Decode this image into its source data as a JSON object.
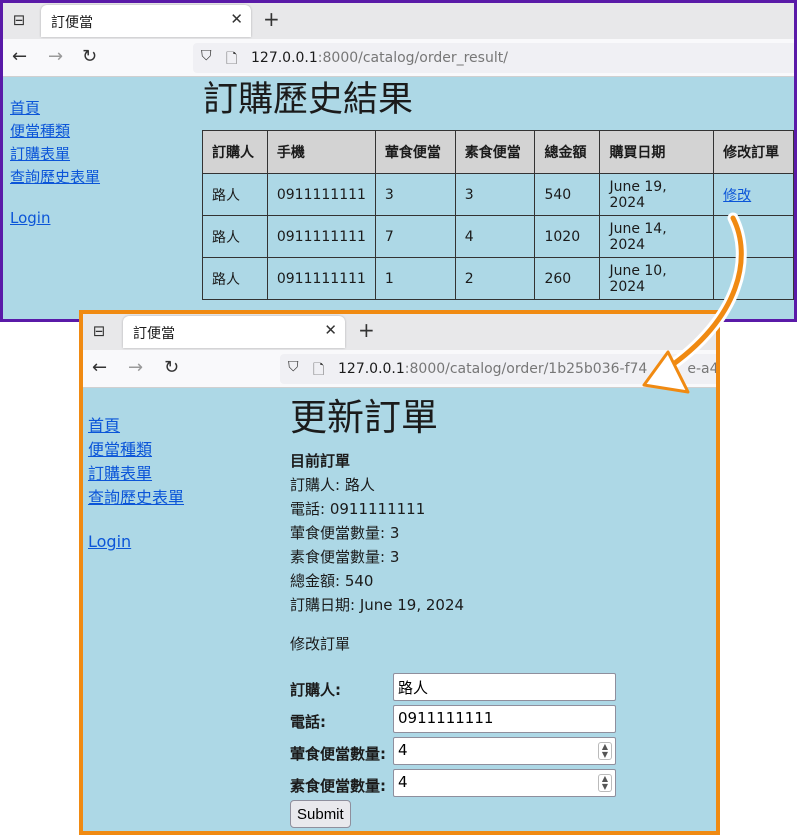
{
  "win1": {
    "tab_title": "訂便當",
    "url_host": "127.0.0.1",
    "url_rest": ":8000/catalog/order_result/",
    "sidebar": [
      "首頁",
      "便當種類",
      "訂購表單",
      "查詢歷史表單"
    ],
    "login": "Login",
    "heading": "訂購歷史結果",
    "table": {
      "headers": [
        "訂購人",
        "手機",
        "葷食便當",
        "素食便當",
        "總金額",
        "購買日期",
        "修改訂單"
      ],
      "rows": [
        {
          "name": "路人",
          "phone": "0911111111",
          "meat": "3",
          "veg": "3",
          "total": "540",
          "date": "June 19, 2024",
          "edit": "修改"
        },
        {
          "name": "路人",
          "phone": "0911111111",
          "meat": "7",
          "veg": "4",
          "total": "1020",
          "date": "June 14, 2024",
          "edit": ""
        },
        {
          "name": "路人",
          "phone": "0911111111",
          "meat": "1",
          "veg": "2",
          "total": "260",
          "date": "June 10, 2024",
          "edit": ""
        }
      ]
    }
  },
  "win2": {
    "tab_title": "訂便當",
    "url_host": "127.0.0.1",
    "url_rest": ":8000/catalog/order/1b25b036-f74",
    "url_tail": "e-a4",
    "sidebar": [
      "首頁",
      "便當種類",
      "訂購表單",
      "查詢歷史表單"
    ],
    "login": "Login",
    "heading": "更新訂單",
    "current": {
      "title": "目前訂單",
      "lines": [
        "訂購人: 路人",
        "電話: 0911111111",
        "葷食便當數量: 3",
        "素食便當數量: 3",
        "總金額: 540",
        "訂購日期: June 19, 2024"
      ]
    },
    "modify_label": "修改訂單",
    "form": {
      "name_label": "訂購人:",
      "name_value": "路人",
      "phone_label": "電話:",
      "phone_value": "0911111111",
      "meat_label": "葷食便當數量:",
      "meat_value": "4",
      "veg_label": "素食便當數量:",
      "veg_value": "4",
      "submit": "Submit"
    }
  },
  "icons": {
    "tab_icon": "tab-overview-icon",
    "close": "close-icon",
    "new_tab": "plus-icon",
    "back": "back-arrow-icon",
    "forward": "forward-arrow-icon",
    "reload": "reload-icon",
    "shield": "shield-icon",
    "page": "page-icon",
    "arrow": "curved-arrow-icon"
  },
  "colors": {
    "page_bg": "#add8e6",
    "window1_border": "#5a1aa8",
    "window2_border": "#f08a12",
    "link": "#0b55d8",
    "header_bg": "#d3d3d3"
  }
}
